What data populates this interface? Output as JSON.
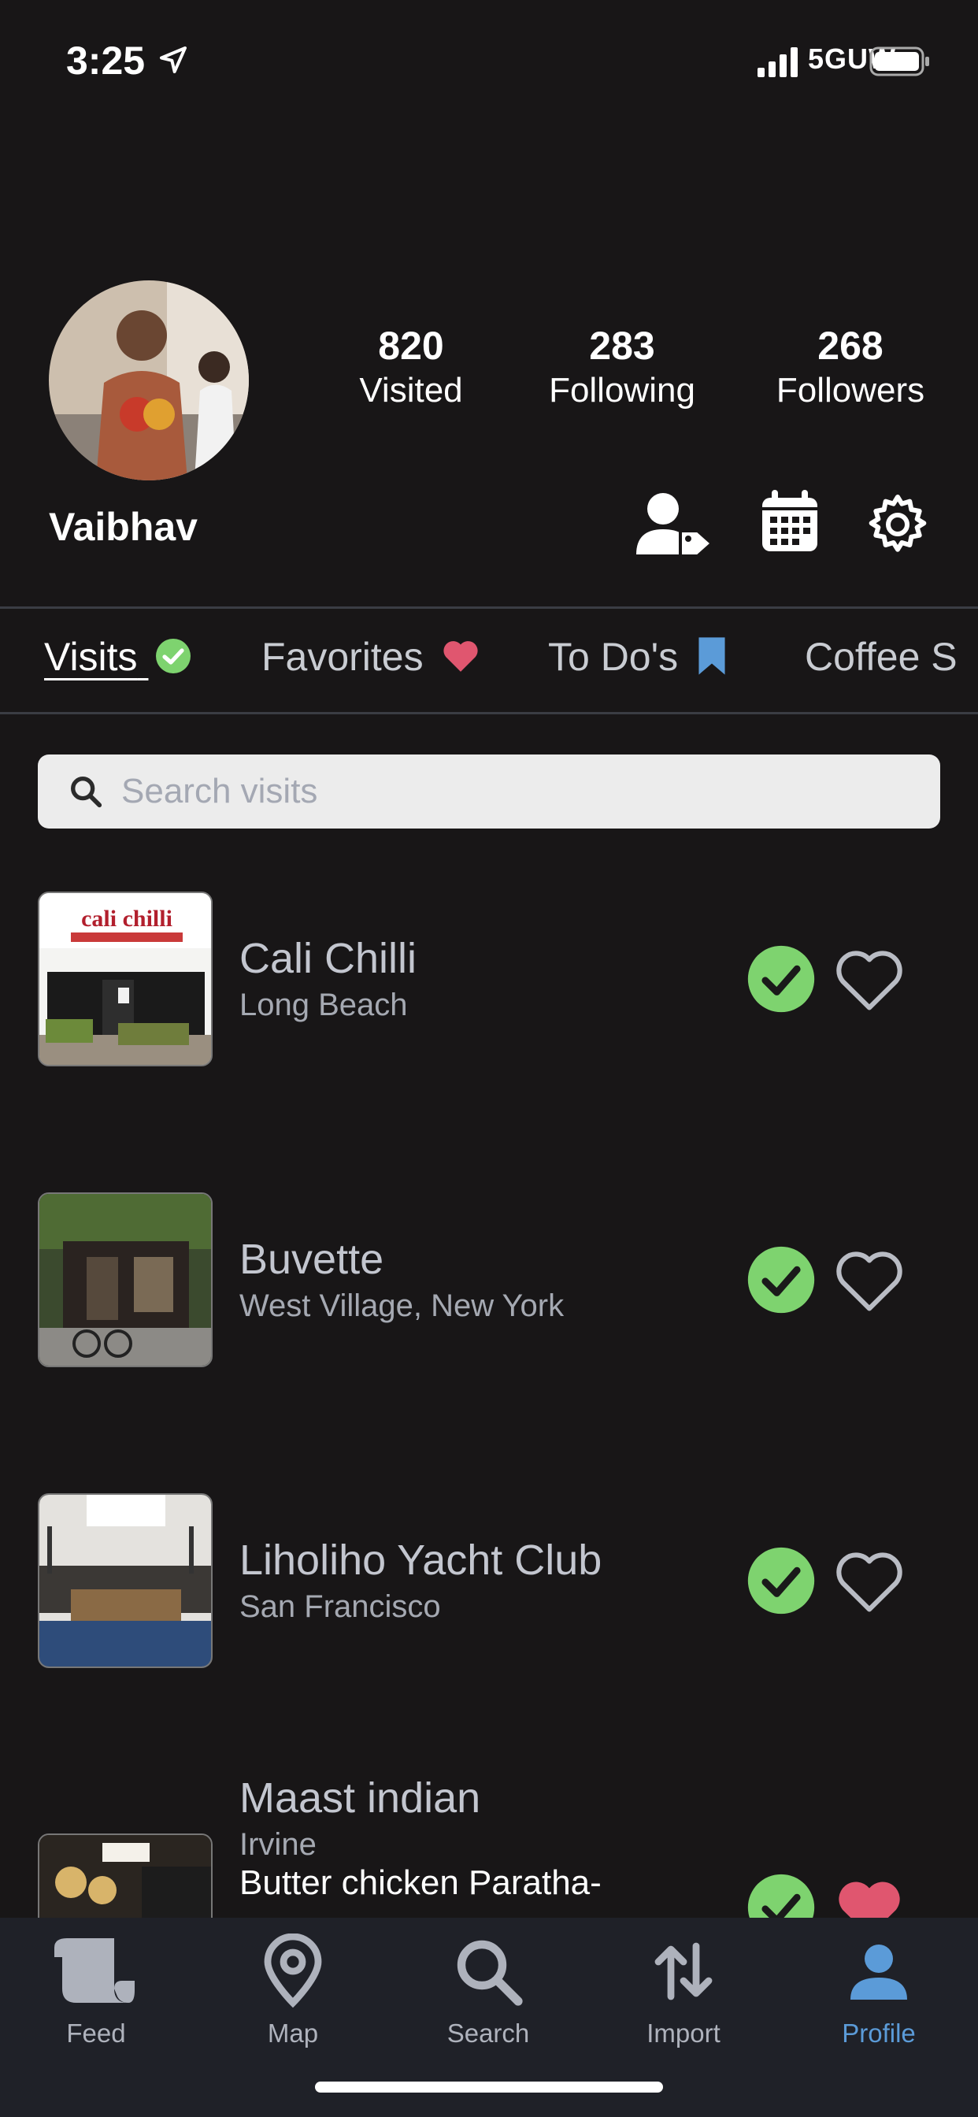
{
  "status_bar": {
    "time": "3:25",
    "network": "5GUW"
  },
  "profile": {
    "username": "Vaibhav",
    "stats": [
      {
        "value": "820",
        "label": "Visited"
      },
      {
        "value": "283",
        "label": "Following"
      },
      {
        "value": "268",
        "label": "Followers"
      }
    ]
  },
  "tabs": [
    {
      "label": "Visits",
      "icon": "check-circle-icon",
      "active": true
    },
    {
      "label": "Favorites",
      "icon": "heart-icon",
      "active": false
    },
    {
      "label": "To Do's",
      "icon": "bookmark-icon",
      "active": false
    },
    {
      "label": "Coffee S",
      "active": false
    }
  ],
  "search": {
    "placeholder": "Search visits"
  },
  "visits": [
    {
      "name": "Cali Chilli",
      "location": "Long Beach",
      "visited": true,
      "favorite": false,
      "thumb_text": "cali chilli"
    },
    {
      "name": "Buvette",
      "location": "West Village, New York",
      "visited": true,
      "favorite": false
    },
    {
      "name": "Liholiho Yacht Club",
      "location": "San Francisco",
      "visited": true,
      "favorite": false
    },
    {
      "name": "Maast indian",
      "location": "Irvine",
      "note": "Butter chicken Paratha-",
      "visited": true,
      "favorite": true
    }
  ],
  "tab_bar": [
    {
      "label": "Feed",
      "icon": "scroll-icon",
      "active": false
    },
    {
      "label": "Map",
      "icon": "map-pin-icon",
      "active": false
    },
    {
      "label": "Search",
      "icon": "search-icon",
      "active": false
    },
    {
      "label": "Import",
      "icon": "import-arrows-icon",
      "active": false
    },
    {
      "label": "Profile",
      "icon": "person-icon",
      "active": true
    }
  ],
  "colors": {
    "background": "#181617",
    "check_green": "#7ed36f",
    "heart_pink": "#e0566f",
    "bookmark_blue": "#5b9bd8",
    "active_tab_blue": "#5b9bd8"
  }
}
